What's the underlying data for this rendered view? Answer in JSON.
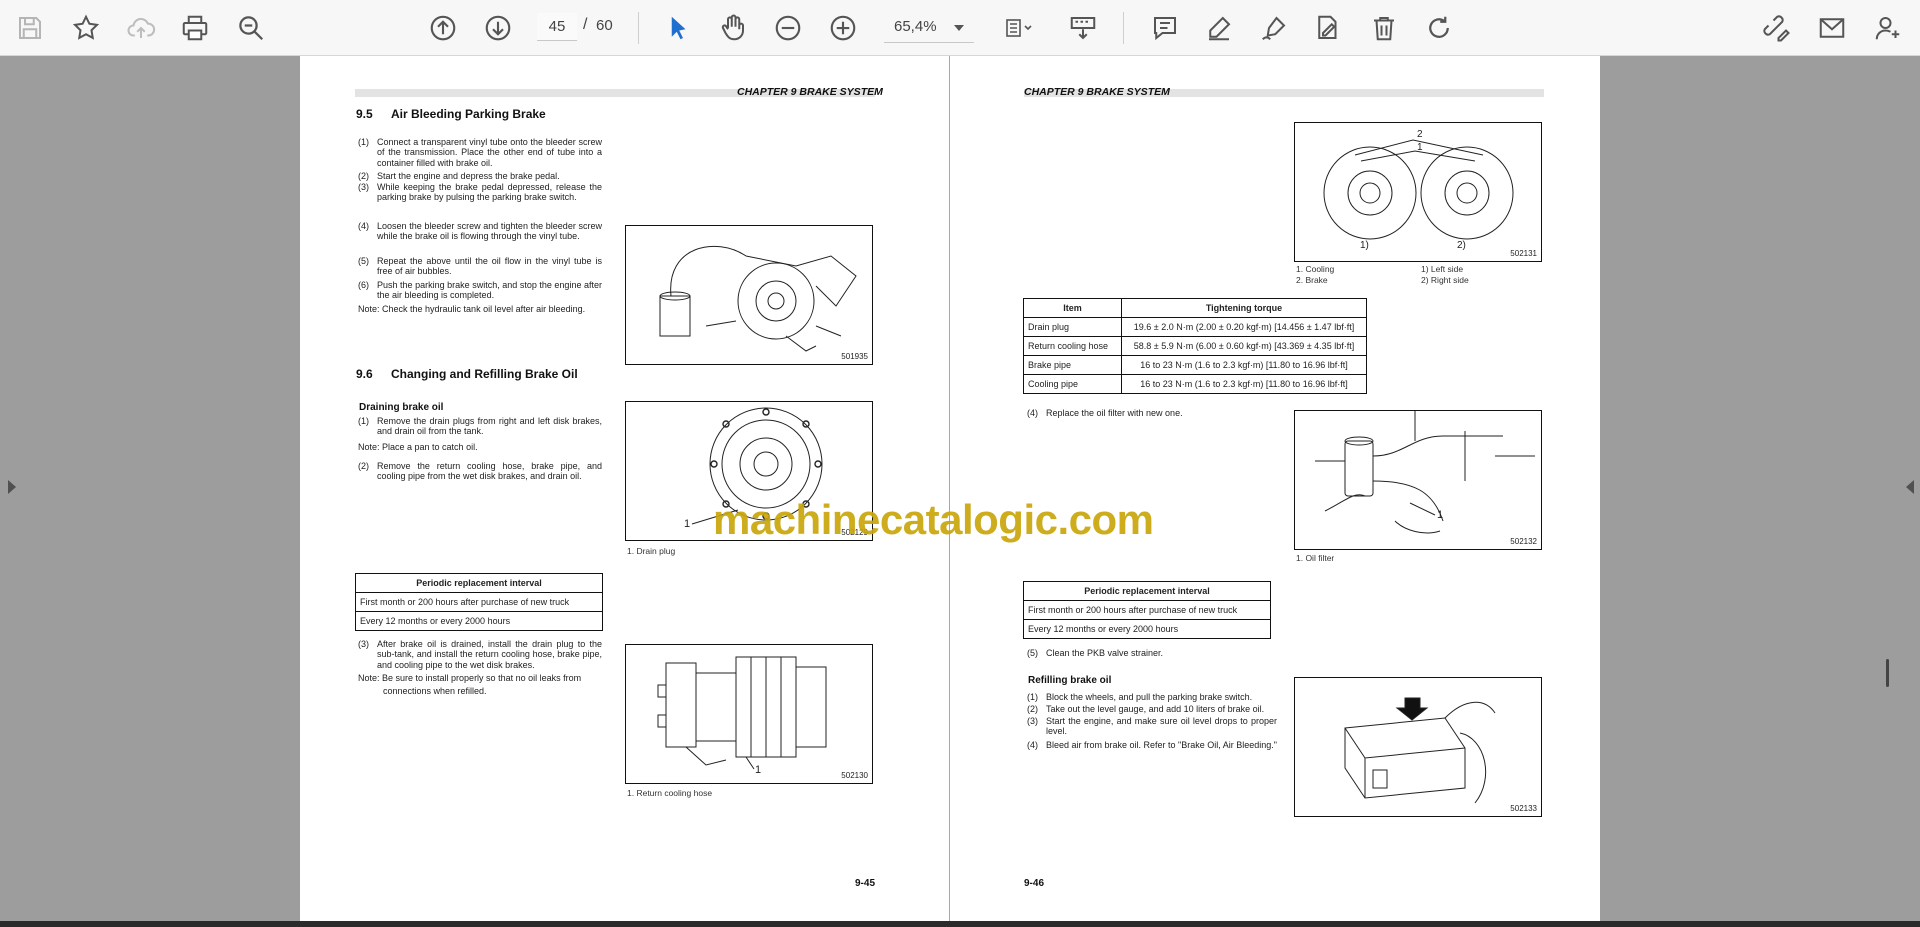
{
  "toolbar": {
    "page_current": "45",
    "page_separator": "/",
    "page_total": "60",
    "zoom": "65,4%"
  },
  "left_page": {
    "chapter_header": "CHAPTER 9 BRAKE SYSTEM",
    "section_95": {
      "num": "9.5",
      "title": "Air Bleeding Parking Brake"
    },
    "steps_95": [
      {
        "num": "(1)",
        "text": "Connect a transparent vinyl tube onto the bleeder screw of the transmission. Place the other end of tube into a container filled with brake oil."
      },
      {
        "num": "(2)",
        "text": "Start the engine and depress the brake pedal."
      },
      {
        "num": "(3)",
        "text": "While keeping the brake pedal depressed, release the parking brake by pulsing the parking brake switch."
      },
      {
        "num": "(4)",
        "text": "Loosen the bleeder screw and tighten the bleeder screw while the brake oil is flowing through the vinyl tube."
      },
      {
        "num": "(5)",
        "text": "Repeat the above until the oil flow in the vinyl tube is free of air bubbles."
      },
      {
        "num": "(6)",
        "text": "Push the parking brake switch, and stop the engine after the air bleeding is completed."
      }
    ],
    "note_95": "Note: Check the hydraulic tank oil level after air bleeding.",
    "fig_501935": "501935",
    "section_96": {
      "num": "9.6",
      "title": "Changing and Refilling Brake Oil"
    },
    "draining_title": "Draining brake oil",
    "drain_step1": {
      "num": "(1)",
      "text": "Remove the drain plugs from right and left disk brakes, and drain oil from the tank."
    },
    "drain_note": "Note: Place a pan to catch oil.",
    "drain_step2": {
      "num": "(2)",
      "text": "Remove the return cooling hose, brake pipe, and cooling pipe from the wet disk brakes, and drain oil."
    },
    "fig_502129": "502129",
    "fig_502129_label": "1",
    "caption_502129": "1.  Drain plug",
    "interval_table": {
      "header": "Periodic replacement interval",
      "rows": [
        "First month or 200 hours after purchase of new truck",
        "Every 12 months or every 2000 hours"
      ]
    },
    "drain_step3": {
      "num": "(3)",
      "text": "After brake oil is drained, install the drain plug to the sub-tank, and install the return cooling hose, brake pipe, and cooling pipe to the wet disk brakes."
    },
    "drain_note2_line1": "Note: Be sure to install properly so that no oil leaks from",
    "drain_note2_line2": "connections when refilled.",
    "fig_502130": "502130",
    "fig_502130_label": "1",
    "caption_502130": "1.  Return cooling hose",
    "page_number": "9-45"
  },
  "right_page": {
    "chapter_header": "CHAPTER 9 BRAKE SYSTEM",
    "fig_502131": "502131",
    "fig_502131_labels": {
      "two": "2",
      "one": "1",
      "left": "1)",
      "right": "2)"
    },
    "caption_502131": {
      "c1": "1.  Cooling",
      "c2": "2.  Brake",
      "c3": "1) Left side",
      "c4": "2) Right side"
    },
    "torque_table": {
      "col1": "Item",
      "col2": "Tightening torque",
      "rows": [
        {
          "item": "Drain plug",
          "torque": "19.6 ± 2.0 N·m  (2.00 ± 0.20 kgf·m) [14.456 ± 1.47 lbf·ft]"
        },
        {
          "item": "Return cooling hose",
          "torque": "58.8 ± 5.9 N·m  (6.00 ± 0.60 kgf·m) [43.369 ± 4.35 lbf·ft]"
        },
        {
          "item": "Brake pipe",
          "torque": "16 to 23 N·m (1.6 to 2.3 kgf·m) [11.80 to 16.96 lbf·ft]"
        },
        {
          "item": "Cooling pipe",
          "torque": "16 to 23 N·m (1.6 to 2.3 kgf·m) [11.80 to 16.96 lbf·ft]"
        }
      ]
    },
    "step4": {
      "num": "(4)",
      "text": "Replace the oil filter with new one."
    },
    "fig_502132": "502132",
    "fig_502132_label": "1",
    "caption_502132": "1.  Oil filter",
    "interval_table": {
      "header": "Periodic replacement interval",
      "rows": [
        "First month or 200 hours after purchase of new truck",
        "Every 12 months or every 2000 hours"
      ]
    },
    "step5": {
      "num": "(5)",
      "text": "Clean the PKB valve strainer."
    },
    "refilling_title": "Refilling brake oil",
    "refill_steps": [
      {
        "num": "(1)",
        "text": "Block the wheels, and pull the parking brake switch."
      },
      {
        "num": "(2)",
        "text": "Take out the level gauge, and add 10 liters of brake oil."
      },
      {
        "num": "(3)",
        "text": "Start the engine, and make sure oil level drops to proper level."
      },
      {
        "num": "(4)",
        "text": "Bleed air from brake oil. Refer to \"Brake Oil, Air Bleeding.\""
      }
    ],
    "fig_502133": "502133",
    "page_number": "9-46"
  },
  "watermark": "machinecatalogic.com"
}
